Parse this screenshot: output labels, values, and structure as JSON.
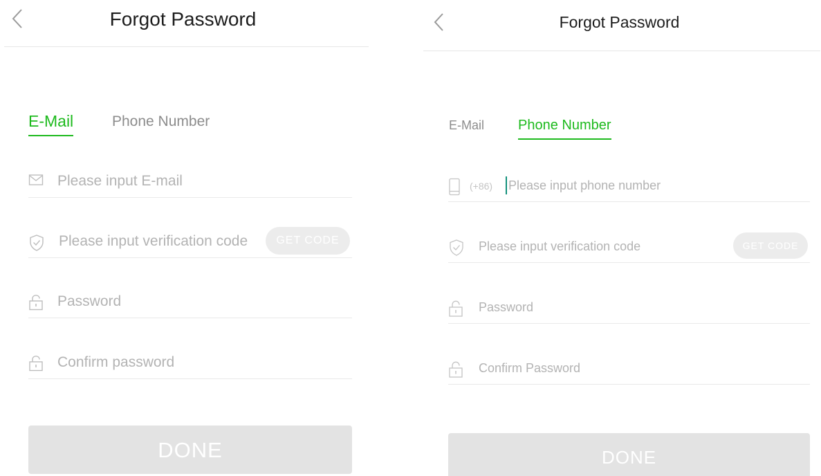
{
  "colors": {
    "accent": "#1dba1d",
    "tab_inactive": "#8c8c8c",
    "placeholder": "#b3b3b3",
    "button_disabled_bg": "#e3e3e3",
    "caret": "#11907a"
  },
  "email_screen": {
    "header": {
      "title": "Forgot Password",
      "back_icon": "chevron-left-icon"
    },
    "tabs": [
      {
        "label": "E-Mail",
        "active": true
      },
      {
        "label": "Phone Number",
        "active": false
      }
    ],
    "fields": [
      {
        "icon": "mail-icon",
        "placeholder": "Please input E-mail",
        "value": ""
      },
      {
        "icon": "shield-check-icon",
        "placeholder": "Please input verification code",
        "value": ""
      },
      {
        "icon": "lock-icon",
        "placeholder": "Password",
        "value": ""
      },
      {
        "icon": "lock-icon",
        "placeholder": "Confirm password",
        "value": ""
      }
    ],
    "get_code_label": "GET CODE",
    "done_label": "DONE"
  },
  "phone_screen": {
    "header": {
      "title": "Forgot Password",
      "back_icon": "chevron-left-icon"
    },
    "tabs": [
      {
        "label": "E-Mail",
        "active": false
      },
      {
        "label": "Phone Number",
        "active": true
      }
    ],
    "country_code": "(+86)",
    "fields": [
      {
        "icon": "phone-icon",
        "placeholder": "Please input phone number",
        "value": ""
      },
      {
        "icon": "shield-check-icon",
        "placeholder": "Please input verification code",
        "value": ""
      },
      {
        "icon": "lock-icon",
        "placeholder": "Password",
        "value": ""
      },
      {
        "icon": "lock-icon",
        "placeholder": "Confirm Password",
        "value": ""
      }
    ],
    "get_code_label": "GET CODE",
    "done_label": "DONE"
  }
}
